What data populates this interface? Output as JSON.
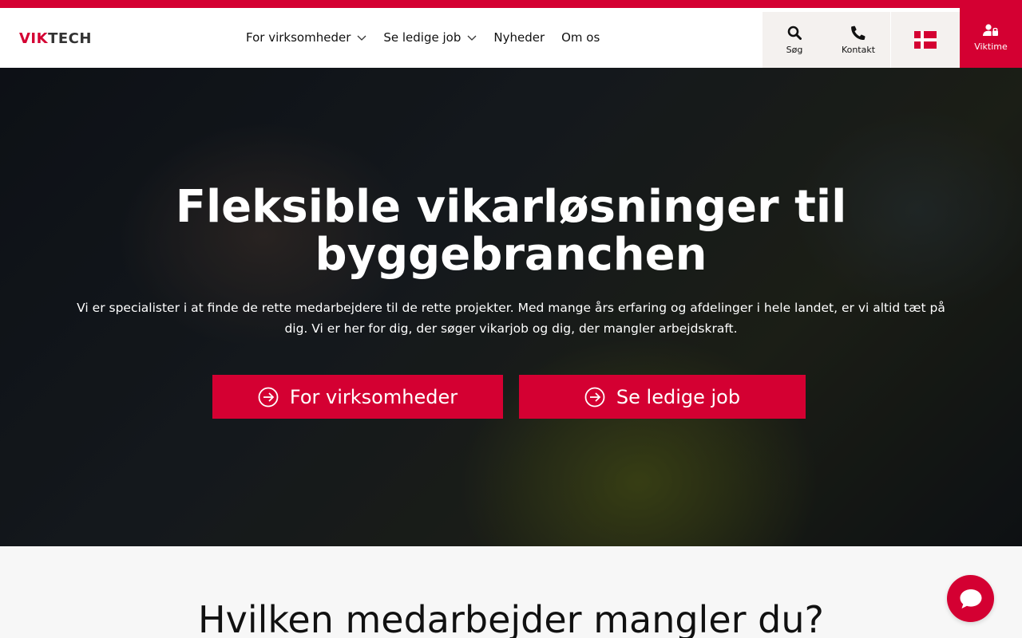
{
  "brand": {
    "logo_left": "VIK",
    "logo_right": "TECH",
    "accent": "#d40032"
  },
  "nav": {
    "items": [
      {
        "label": "For virksomheder",
        "dropdown": true
      },
      {
        "label": "Se ledige job",
        "dropdown": true
      },
      {
        "label": "Nyheder",
        "dropdown": false
      },
      {
        "label": "Om os",
        "dropdown": false
      }
    ]
  },
  "tools": {
    "search": {
      "label": "Søg",
      "icon": "search-icon"
    },
    "contact": {
      "label": "Kontakt",
      "icon": "phone-icon"
    },
    "language": {
      "icon": "danish-flag-icon"
    },
    "viktime": {
      "label": "Viktime",
      "icon": "user-lock-icon"
    }
  },
  "hero": {
    "title": "Fleksible vikarløsninger til byggebranchen",
    "text": "Vi er specialister i at finde de rette medarbejdere til de rette projekter. Med mange års erfaring og afdelinger i hele landet, er vi altid tæt på dig. Vi er her for dig, der søger vikarjob og dig, der mangler arbejdskraft.",
    "buttons": [
      {
        "label": "For virksomheder",
        "icon": "arrow-circle-right-icon"
      },
      {
        "label": "Se ledige job",
        "icon": "arrow-circle-right-icon"
      }
    ]
  },
  "section": {
    "title": "Hvilken medarbejder mangler du?"
  },
  "chat": {
    "icon": "chat-bubble-icon"
  }
}
